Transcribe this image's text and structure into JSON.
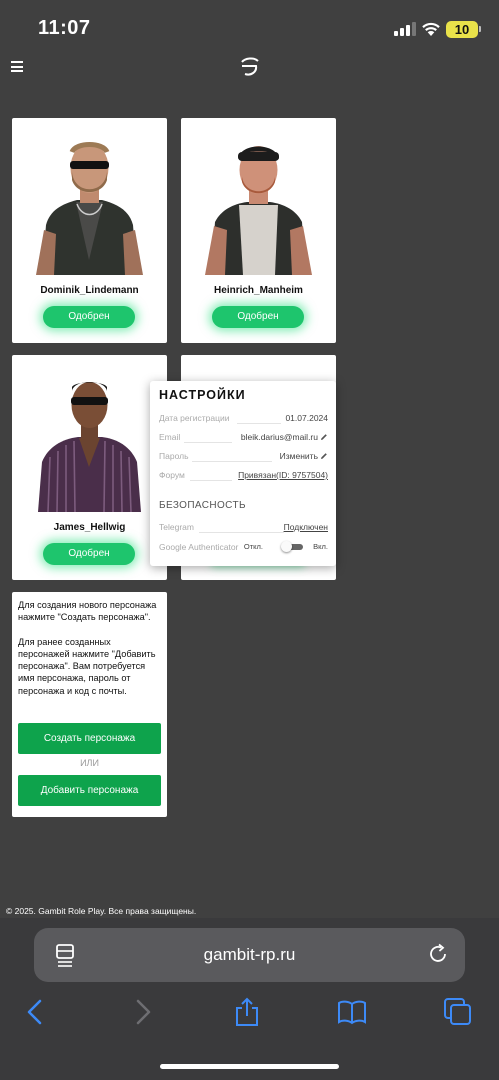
{
  "status_bar": {
    "time": "11:07",
    "battery": "10"
  },
  "header": {
    "menu_icon": "hamburger-icon",
    "logo_icon": "gambit-logo"
  },
  "characters": [
    {
      "name": "Dominik_Lindemann",
      "status": "Одобрен"
    },
    {
      "name": "Heinrich_Manheim",
      "status": "Одобрен"
    },
    {
      "name": "James_Hellwig",
      "status": "Одобрен"
    }
  ],
  "info_card": {
    "paragraph1": "Для создания нового персонажа нажмите \"Создать персонажа\".",
    "paragraph2": "Для ранее созданных персонажей нажмите \"Добавить персонажа\". Вам потребуется имя персонажа, пароль от персонажа и код с почты.",
    "create_button": "Создать персонажа",
    "or_label": "ИЛИ",
    "add_button": "Добавить персонажа"
  },
  "settings": {
    "title": "НАСТРОЙКИ",
    "rows": [
      {
        "label": "Дата регистрации",
        "value": "01.07.2024"
      },
      {
        "label": "Email",
        "value": "bleik.darius@mail.ru"
      },
      {
        "label": "Пароль",
        "value": "Изменить"
      },
      {
        "label": "Форум",
        "value": "Привязан(ID: 9757504)"
      }
    ],
    "security_title": "БЕЗОПАСНОСТЬ",
    "telegram_label": "Telegram",
    "telegram_value": "Подключен",
    "ga_label": "Google Authenticator",
    "ga_off": "Откл.",
    "ga_on": "Вкл."
  },
  "footer": {
    "copyright": "© 2025. Gambit Role Play. Все права защищены."
  },
  "browser": {
    "url": "gambit-rp.ru"
  },
  "colors": {
    "background": "#404040",
    "approve_green": "#1ec56d",
    "button_green": "#0ea34c",
    "safari_bar": "#3a3a3c",
    "accent_blue": "#3d8af7"
  }
}
